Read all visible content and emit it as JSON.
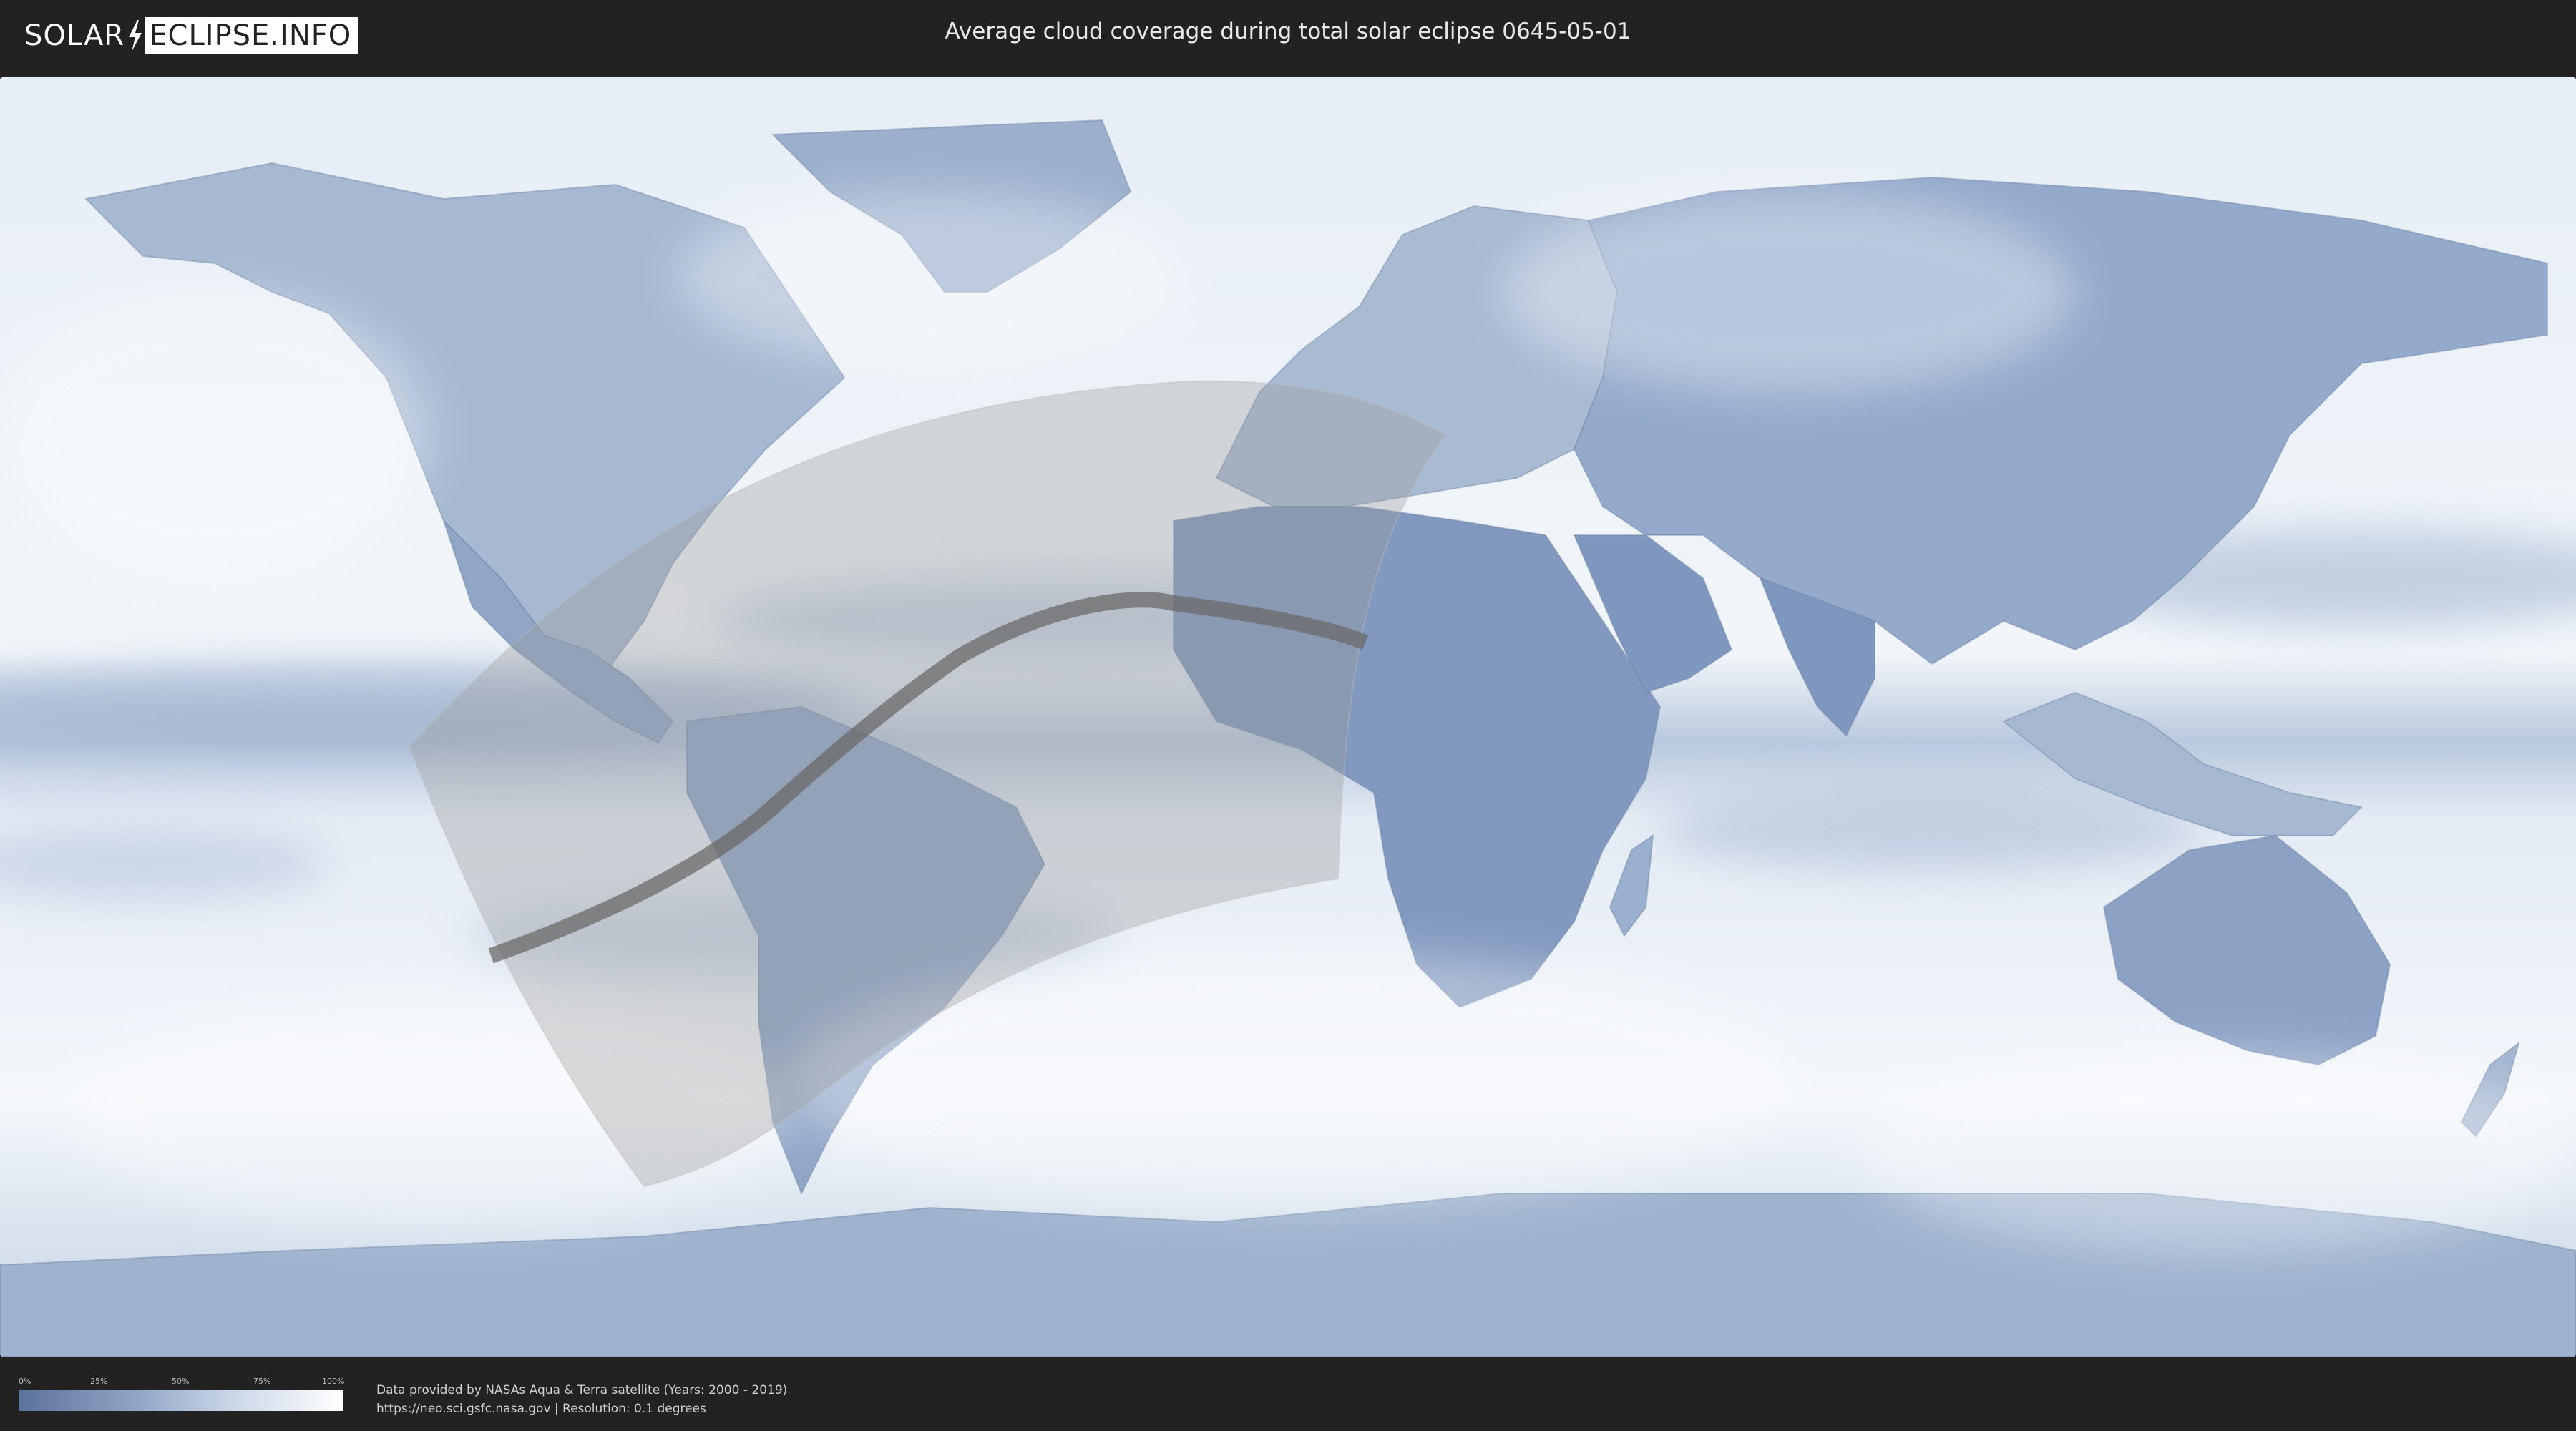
{
  "header": {
    "logo_left": "SOLAR",
    "logo_right": "ECLIPSE.INFO",
    "title": "Average cloud coverage during total solar eclipse 0645-05-01"
  },
  "legend": {
    "ticks": [
      "0%",
      "25%",
      "50%",
      "75%",
      "100%"
    ],
    "colors": {
      "low": "#5b729b",
      "high": "#ffffff"
    }
  },
  "credits": {
    "line1": "Data provided by NASAs Aqua & Terra satellite (Years: 2000 - 2019)",
    "line2": "https://neo.sci.gsfc.nasa.gov | Resolution: 0.1 degrees"
  },
  "map": {
    "projection": "equirectangular",
    "colors": {
      "ocean_cloud": "#eef3f8",
      "land_clear": "#7d97bd",
      "penumbra": "#9a9a9a",
      "totality_path": "#6a6a6a"
    }
  }
}
